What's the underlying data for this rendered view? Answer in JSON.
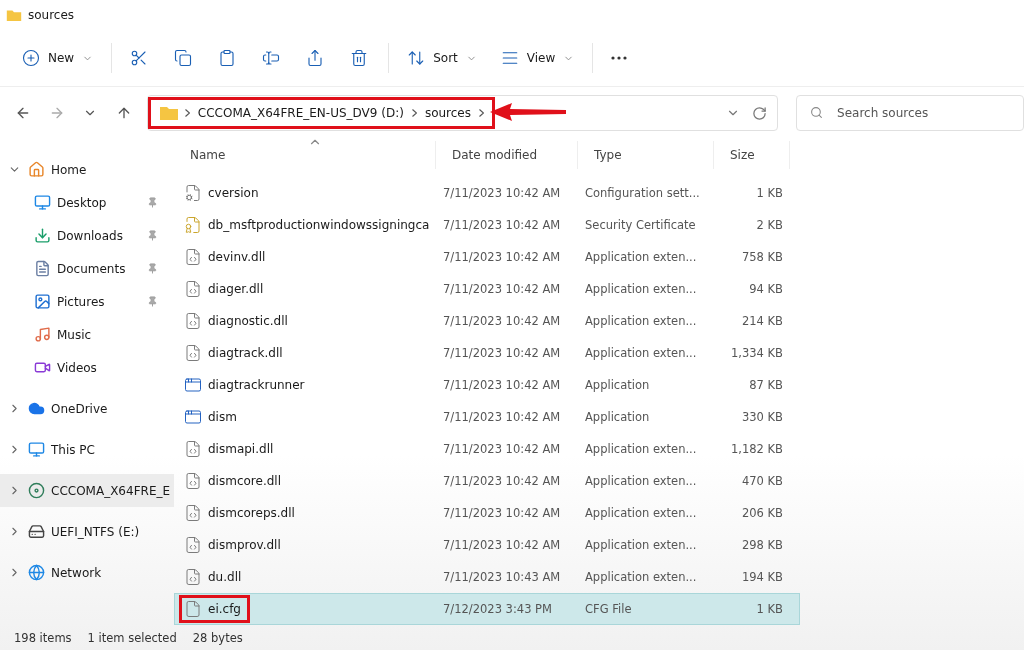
{
  "window": {
    "title": "sources"
  },
  "toolbar": {
    "items": [
      {
        "kind": "new",
        "label": "New",
        "dropdown": true
      },
      {
        "kind": "cut"
      },
      {
        "kind": "copy"
      },
      {
        "kind": "paste"
      },
      {
        "kind": "rename"
      },
      {
        "kind": "share"
      },
      {
        "kind": "delete"
      },
      {
        "kind": "sort",
        "label": "Sort",
        "dropdown": true
      },
      {
        "kind": "view",
        "label": "View",
        "dropdown": true
      },
      {
        "kind": "more"
      }
    ]
  },
  "address_bar": {
    "highlighted": true,
    "crumbs": [
      "CCCOMA_X64FRE_EN-US_DV9 (D:)",
      "sources"
    ]
  },
  "search": {
    "placeholder": "Search sources"
  },
  "sidebar": {
    "items": [
      {
        "label": "Home",
        "kind": "home",
        "expanded": true,
        "selected": false,
        "children": [
          {
            "label": "Desktop",
            "kind": "desktop",
            "pinned": true
          },
          {
            "label": "Downloads",
            "kind": "downloads",
            "pinned": true
          },
          {
            "label": "Documents",
            "kind": "documents",
            "pinned": true
          },
          {
            "label": "Pictures",
            "kind": "pictures",
            "pinned": true
          },
          {
            "label": "Music",
            "kind": "music",
            "pinned": false
          },
          {
            "label": "Videos",
            "kind": "videos",
            "pinned": false
          }
        ]
      },
      {
        "label": "OneDrive",
        "kind": "cloud",
        "expanded": false,
        "selected": false
      },
      {
        "label": "This PC",
        "kind": "pc",
        "expanded": false,
        "selected": false
      },
      {
        "label": "CCCOMA_X64FRE_E",
        "kind": "disc",
        "expanded": false,
        "selected": true
      },
      {
        "label": "UEFI_NTFS (E:)",
        "kind": "drive",
        "expanded": false,
        "selected": false
      },
      {
        "label": "Network",
        "kind": "network",
        "expanded": false,
        "selected": false
      }
    ]
  },
  "table": {
    "columns": [
      "Name",
      "Date modified",
      "Type",
      "Size"
    ],
    "rows": [
      {
        "kind": "config",
        "name": "cversion",
        "date": "7/11/2023 10:42 AM",
        "type": "Configuration sett...",
        "size": "1 KB",
        "selected": false,
        "highlighted": false
      },
      {
        "kind": "cert",
        "name": "db_msftproductionwindowssigningca",
        "date": "7/11/2023 10:42 AM",
        "type": "Security Certificate",
        "size": "2 KB",
        "selected": false,
        "highlighted": false
      },
      {
        "kind": "dll",
        "name": "devinv.dll",
        "date": "7/11/2023 10:42 AM",
        "type": "Application exten...",
        "size": "758 KB",
        "selected": false,
        "highlighted": false
      },
      {
        "kind": "dll",
        "name": "diager.dll",
        "date": "7/11/2023 10:42 AM",
        "type": "Application exten...",
        "size": "94 KB",
        "selected": false,
        "highlighted": false
      },
      {
        "kind": "dll",
        "name": "diagnostic.dll",
        "date": "7/11/2023 10:42 AM",
        "type": "Application exten...",
        "size": "214 KB",
        "selected": false,
        "highlighted": false
      },
      {
        "kind": "dll",
        "name": "diagtrack.dll",
        "date": "7/11/2023 10:42 AM",
        "type": "Application exten...",
        "size": "1,334 KB",
        "selected": false,
        "highlighted": false
      },
      {
        "kind": "app",
        "name": "diagtrackrunner",
        "date": "7/11/2023 10:42 AM",
        "type": "Application",
        "size": "87 KB",
        "selected": false,
        "highlighted": false
      },
      {
        "kind": "app",
        "name": "dism",
        "date": "7/11/2023 10:42 AM",
        "type": "Application",
        "size": "330 KB",
        "selected": false,
        "highlighted": false
      },
      {
        "kind": "dll",
        "name": "dismapi.dll",
        "date": "7/11/2023 10:42 AM",
        "type": "Application exten...",
        "size": "1,182 KB",
        "selected": false,
        "highlighted": false
      },
      {
        "kind": "dll",
        "name": "dismcore.dll",
        "date": "7/11/2023 10:42 AM",
        "type": "Application exten...",
        "size": "470 KB",
        "selected": false,
        "highlighted": false
      },
      {
        "kind": "dll",
        "name": "dismcoreps.dll",
        "date": "7/11/2023 10:42 AM",
        "type": "Application exten...",
        "size": "206 KB",
        "selected": false,
        "highlighted": false
      },
      {
        "kind": "dll",
        "name": "dismprov.dll",
        "date": "7/11/2023 10:42 AM",
        "type": "Application exten...",
        "size": "298 KB",
        "selected": false,
        "highlighted": false
      },
      {
        "kind": "dll",
        "name": "du.dll",
        "date": "7/11/2023 10:43 AM",
        "type": "Application exten...",
        "size": "194 KB",
        "selected": false,
        "highlighted": false
      },
      {
        "kind": "blank",
        "name": "ei.cfg",
        "date": "7/12/2023 3:43 PM",
        "type": "CFG File",
        "size": "1 KB",
        "selected": true,
        "highlighted": true
      }
    ]
  },
  "status_bar": [
    "198 items",
    "1 item selected",
    "28 bytes"
  ]
}
